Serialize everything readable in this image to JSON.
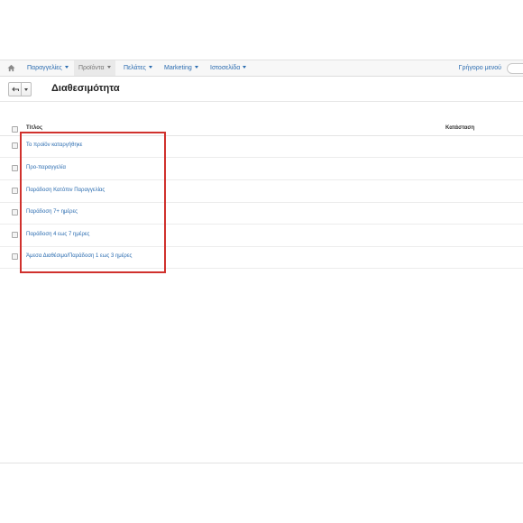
{
  "nav": {
    "items": [
      {
        "label": "Παραγγελίες"
      },
      {
        "label": "Προϊόντα"
      },
      {
        "label": "Πελάτες"
      },
      {
        "label": "Marketing"
      },
      {
        "label": "Ιστοσελίδα"
      }
    ],
    "quick_menu": "Γρήγορο μενού",
    "icons": {
      "home": "home-icon"
    }
  },
  "header": {
    "title": "Διαθεσιμότητα",
    "back_icon": "back-arrow-icon",
    "dropdown_icon": "caret-down-icon"
  },
  "table": {
    "columns": {
      "title": "Τίτλος",
      "status": "Κατάσταση"
    },
    "rows": [
      {
        "title": "Το προϊόν καταργήθηκε"
      },
      {
        "title": "Προ-παραγγελία"
      },
      {
        "title": "Παράδοση Κατόπιν Παραγγελίας"
      },
      {
        "title": "Παράδοση 7+ ημέρες"
      },
      {
        "title": "Παράδοση 4 εως 7 ημέρες"
      },
      {
        "title": "Άμεσα Διαθέσιμο/Παράδοση 1 εως 3 ημέρες"
      }
    ]
  },
  "colors": {
    "link": "#2b6cb0",
    "highlight": "#d0312d"
  }
}
